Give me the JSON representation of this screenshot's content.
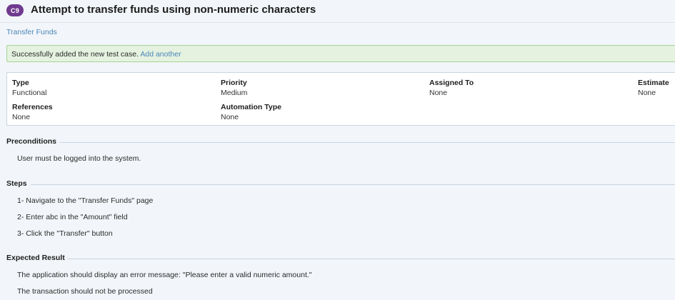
{
  "header": {
    "badge": "C9",
    "title": "Attempt to transfer funds using non-numeric characters"
  },
  "breadcrumb": "Transfer Funds",
  "notice": {
    "text": "Successfully added the new test case. ",
    "link": "Add another"
  },
  "fields": {
    "type": {
      "label": "Type",
      "value": "Functional"
    },
    "priority": {
      "label": "Priority",
      "value": "Medium"
    },
    "assigned_to": {
      "label": "Assigned To",
      "value": "None"
    },
    "estimate": {
      "label": "Estimate",
      "value": "None"
    },
    "references": {
      "label": "References",
      "value": "None"
    },
    "automation_type": {
      "label": "Automation Type",
      "value": "None"
    }
  },
  "preconditions": {
    "title": "Preconditions",
    "lines": [
      "User must be logged into the system."
    ]
  },
  "steps": {
    "title": "Steps",
    "lines": [
      "1- Navigate to the \"Transfer Funds\" page",
      "2- Enter abc in the \"Amount\" field",
      "3- Click the \"Transfer\" button"
    ]
  },
  "expected": {
    "title": "Expected Result",
    "lines": [
      "The application should display an error message: \"Please enter a valid numeric amount.\"",
      "The transaction should not be processed"
    ]
  }
}
